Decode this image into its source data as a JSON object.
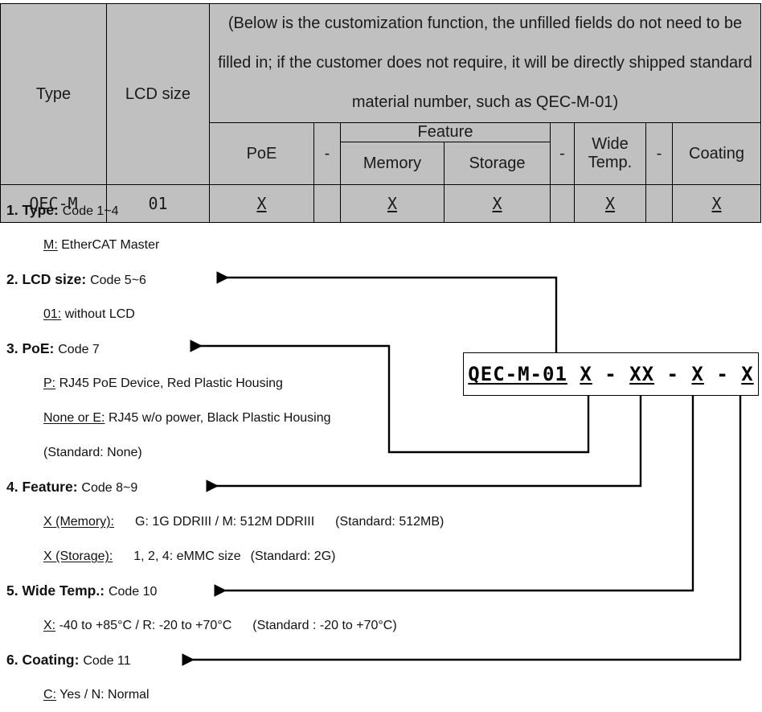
{
  "table": {
    "note": "(Below is the customization function, the unfilled fields do not need to be filled in; if the customer does not require, it will be directly shipped standard material number, such as QEC-M-01)",
    "headers": {
      "type": "Type",
      "lcd_size": "LCD size",
      "poe": "PoE",
      "feature": "Feature",
      "memory": "Memory",
      "storage": "Storage",
      "wide_temp": "Wide Temp.",
      "coating": "Coating",
      "separator": "-"
    },
    "values": {
      "type": "QEC-M",
      "lcd_size": "01",
      "poe": "X",
      "memory": "X",
      "storage": "X",
      "wide_temp": "X",
      "coating": "X"
    }
  },
  "part_number": {
    "prefix": "QEC-M-01",
    "poe": "X",
    "dash1": "-",
    "feature": "XX",
    "dash2": "-",
    "wide_temp": "X",
    "dash3": "-",
    "coating": "X"
  },
  "legend": [
    {
      "num": "1.",
      "title": "Type:",
      "code": "Code 1~4",
      "subs": [
        {
          "key": "M:",
          "text": "EtherCAT Master"
        }
      ]
    },
    {
      "num": "2.",
      "title": "LCD size:",
      "code": "Code 5~6",
      "subs": [
        {
          "key": "01:",
          "text": "without LCD"
        }
      ]
    },
    {
      "num": "3.",
      "title": "PoE:",
      "code": "Code 7",
      "subs": [
        {
          "key": "P:",
          "text": "RJ45 PoE Device, Red Plastic Housing"
        },
        {
          "key": "None or E:",
          "text": "RJ45 w/o power, Black Plastic Housing"
        },
        {
          "key": "",
          "text": "(Standard: None)"
        }
      ]
    },
    {
      "num": "4.",
      "title": "Feature:",
      "code": "Code 8~9",
      "subs": [
        {
          "key": "X (Memory):",
          "text": "G: 1G DDRIII / M: 512M DDRIII",
          "standard": "(Standard: 512MB)"
        },
        {
          "key": "X (Storage):",
          "text": "1, 2, 4: eMMC size",
          "standard": "(Standard: 2G)"
        }
      ]
    },
    {
      "num": "5.",
      "title": "Wide Temp.:",
      "code": "Code 10",
      "subs": [
        {
          "key": "X:",
          "text": "-40 to +85°C / R: -20 to +70°C",
          "standard": "(Standard : -20 to +70°C)"
        }
      ]
    },
    {
      "num": "6.",
      "title": "Coating:",
      "code": "Code 11",
      "subs": [
        {
          "key": "C:",
          "text": "Yes / N: Normal"
        }
      ]
    }
  ],
  "colors": {
    "header_fill": "#C0C0C0",
    "line": "#000000",
    "text": "#111111"
  }
}
